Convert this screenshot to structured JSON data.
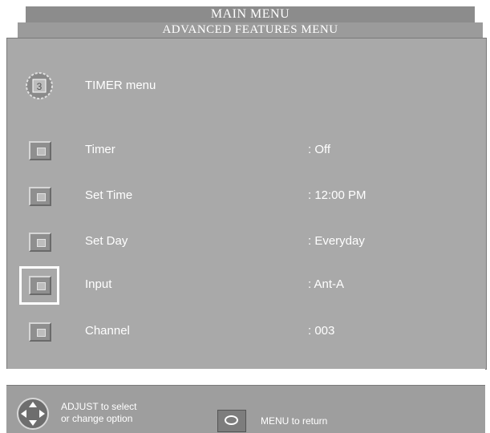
{
  "header": {
    "title": "MAIN MENU",
    "subtitle": "ADVANCED FEATURES MENU"
  },
  "menu": {
    "title": "TIMER menu",
    "icon": "timer-clock-icon"
  },
  "rows": [
    {
      "label": "Timer",
      "value": ": Off"
    },
    {
      "label": "Set Time",
      "value": ": 12:00 PM"
    },
    {
      "label": "Set Day",
      "value": ": Everyday"
    },
    {
      "label": "Input",
      "value": ": Ant-A",
      "selected": true
    },
    {
      "label": "Channel",
      "value": ": 003"
    }
  ],
  "footer": {
    "adjust_hint_line1": "ADJUST to select",
    "adjust_hint_line2": "or change option",
    "menu_hint": "MENU to return",
    "dpad_icon": "dpad-icon",
    "menu_button_icon": "menu-button-icon"
  },
  "colors": {
    "panel": "#a9a9a9",
    "text": "#ffffff"
  }
}
